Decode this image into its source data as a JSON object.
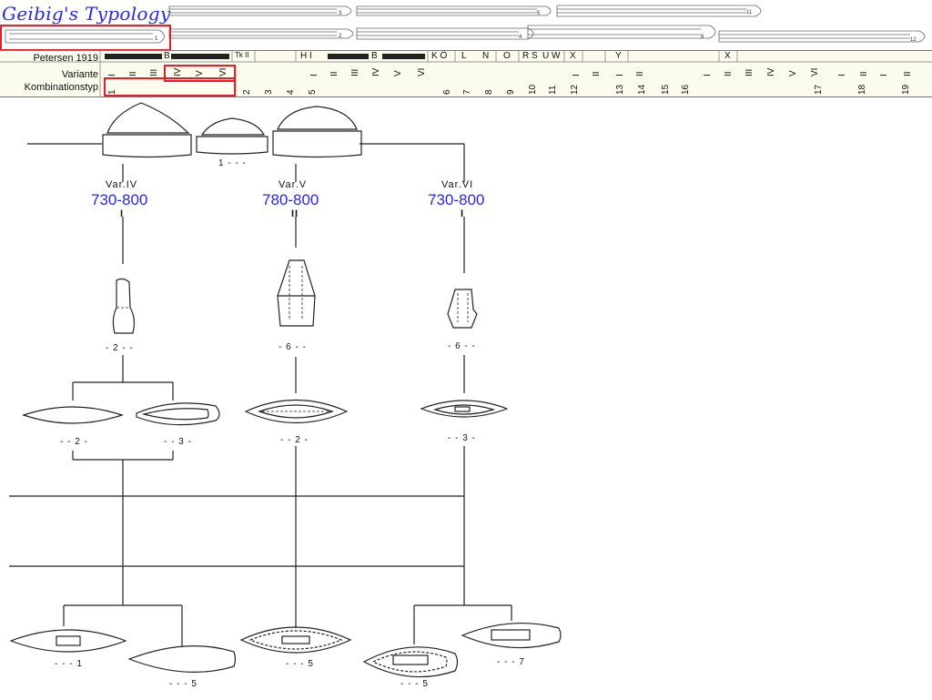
{
  "title": "Geibig's Typology",
  "table": {
    "row_petersen": "Petersen 1919",
    "row_variante": "Variante",
    "row_kombination": "Kombinationstyp",
    "petersen_cells": [
      "B",
      "Tk II",
      "H I",
      "B",
      "K Ö",
      "L",
      "N",
      "O",
      "R S",
      "U W",
      "X",
      "Y",
      "X"
    ],
    "variante_cells": [
      "I",
      "II",
      "III",
      "IV",
      "V",
      "VI",
      "I",
      "II",
      "III",
      "IV",
      "V",
      "VI",
      "I",
      "II",
      "I",
      "II",
      "I",
      "II",
      "III",
      "IV",
      "V",
      "VI",
      "I",
      "II",
      "I",
      "II"
    ],
    "kombination_cells": [
      "1",
      "2",
      "3",
      "4",
      "5",
      "6",
      "7",
      "8",
      "9",
      "10",
      "11",
      "12",
      "13",
      "14",
      "15",
      "16",
      "17",
      "18",
      "19"
    ]
  },
  "branches": [
    {
      "variant": "Var.IV",
      "date": "730-800",
      "mark": "I"
    },
    {
      "variant": "Var.V",
      "date": "780-800",
      "mark": "II"
    },
    {
      "variant": "Var.VI",
      "date": "730-800",
      "mark": "I"
    }
  ],
  "captions": {
    "pommel_group": "1 - - -",
    "grip_a": "- 2 - -",
    "grip_b": "- 6 - -",
    "grip_c": "- 6 - -",
    "guard_a": "- - 2 -",
    "guard_b": "- - 3 -",
    "guard_c": "- - 2 -",
    "guard_d": "- - 3 -",
    "blade_a": "- - - 1",
    "blade_b": "- - - 5",
    "blade_c": "- - - 5",
    "blade_d": "- - - 5",
    "blade_e": "- - - 7"
  },
  "colors": {
    "title": "#2a2ad8",
    "date": "#2a2ad8",
    "highlight": "#e0202a",
    "table_bg": "#fbfbee"
  }
}
